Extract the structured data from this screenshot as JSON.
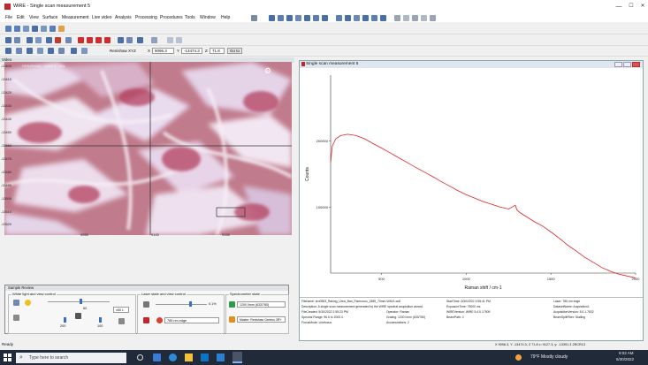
{
  "window": {
    "title": "WiRE - Single scan measurement 5",
    "minimize": "—",
    "maximize": "☐",
    "close": "✕"
  },
  "menu": [
    "File",
    "Edit",
    "View",
    "Surface",
    "Measurement",
    "Live video",
    "Analysis",
    "Processing",
    "Procedures",
    "Tools",
    "Window",
    "Help"
  ],
  "toolbar": {
    "stage_label": "Renishaw XYZ",
    "x_label": "X",
    "x_value": "9096.3",
    "y_label": "Y",
    "y_value": "-13474.3",
    "z_label": "Z",
    "z_value": "71.8",
    "goto_label": "Go to"
  },
  "video": {
    "panel_title": "Video",
    "overlay_text": "RENISHAW  ·  WiRE 5 · 50x",
    "y_ticks": [
      "-13400",
      "-13410",
      "-13420",
      "-13430",
      "-13440",
      "-13450",
      "-13460",
      "-13470",
      "-13480",
      "-13490",
      "-13500",
      "-13510",
      "-13520"
    ],
    "x_ticks": [
      "9050",
      "9100",
      "9150"
    ],
    "icon_settings": "gear-icon"
  },
  "plot": {
    "window_title": "Single scan measurement 5",
    "xlabel": "Raman shift / cm-1",
    "ylabel": "Counts",
    "line_color": "#e02020"
  },
  "chart_data": {
    "type": "line",
    "title": "",
    "xlabel": "Raman shift / cm-1",
    "ylabel": "Counts",
    "xlim": [
      200,
      2000
    ],
    "y_scale": "log",
    "ylim": [
      50000,
      400000
    ],
    "x_ticks": [
      500,
      1000,
      1500,
      2000
    ],
    "y_ticks": [
      100000,
      200000
    ],
    "series": [
      {
        "x": [
          200,
          210,
          230,
          260,
          300,
          350,
          400,
          450,
          500,
          550,
          600,
          650,
          700,
          750,
          800,
          850,
          900,
          950,
          1000,
          1050,
          1100,
          1150,
          1200,
          1250,
          1270,
          1290,
          1300,
          1320,
          1350,
          1400,
          1450,
          1500,
          1550,
          1600,
          1650,
          1700,
          1750,
          1800,
          1850,
          1900,
          1950,
          2000
        ],
        "y": [
          160000,
          190000,
          205000,
          212000,
          215000,
          212000,
          205000,
          195000,
          186000,
          177000,
          168000,
          160000,
          152000,
          145000,
          138000,
          131000,
          125000,
          119000,
          114000,
          110000,
          106000,
          103000,
          100000,
          98000,
          100000,
          102000,
          97000,
          94000,
          91000,
          86000,
          82000,
          77000,
          72000,
          67000,
          63000,
          59000,
          56000,
          53000,
          51000,
          49500,
          48500,
          47500
        ]
      }
    ]
  },
  "metadata": [
    [
      "Filename: srn0983_Raking_Urea_Ban_Flamonoo_1585_70mm-WAV1.wdf",
      "StartTime: 5/30/2022 2:55:41 PM",
      "Laser: 785 nm edge"
    ],
    [
      "Description: A single scan measurement generated by the WiRE spectral acquisition wizard.",
      "ExposureTime: 75000 ms",
      "DatasetName: Acquisition1"
    ],
    [
      "FileCreated: 5/30/2022 2:55:23 PM",
      "Operator: Raman",
      "WiREVersion: WiRE 5.4.0.17909",
      "AcquisitionVersion: 5.0.1.7832"
    ],
    [
      "Spectral Range: 96.6 to 2000.4",
      "Grating: 1200 l/mm (633/780)",
      "BeamPath: 2",
      "BeamSplitFilter: Stalling"
    ],
    [
      "FocusMode: Linefocus",
      "Accumulations: 2"
    ]
  ],
  "sample_review": {
    "title": "Sample Review",
    "white_light_group": "White light and view control",
    "laser_group": "Laser state and view control",
    "spectrometer_group": "Spectrometer state",
    "objective": "x50 L",
    "slider_values": [
      "60",
      "200",
      "100"
    ],
    "laser_power": "0.1%",
    "laser_name": "785 nm edge",
    "grating": "1200 l/mm (633/780)",
    "master": "Master: Renishaw Centrus 3RY"
  },
  "status": {
    "ready": "Ready",
    "coords": "X 9096.3, Y -13474.3, Z 71.8  x: 9127.3, y: -13391.3  2RCR13"
  },
  "taskbar": {
    "search_placeholder": "Type here to search",
    "weather": "79°F  Mostly cloudy",
    "time": "9:02 AM",
    "date": "5/30/2022"
  }
}
